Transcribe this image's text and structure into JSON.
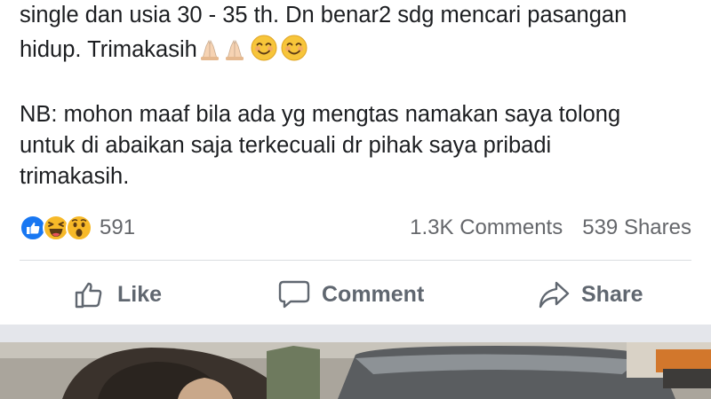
{
  "post": {
    "line1": "single dan usia 30 - 35 th. Dn benar2 sdg mencari pasangan",
    "line2": "hidup. Trimakasih",
    "nb_line1": "NB: mohon maaf bila ada yg mengtas namakan saya tolong",
    "nb_line2": "untuk di abaikan saja terkecuali dr pihak saya pribadi",
    "nb_line3": "trimakasih.",
    "emojis": [
      "folded-hands",
      "folded-hands",
      "smiling-face",
      "smiling-face"
    ]
  },
  "stats": {
    "reactions": [
      "like",
      "haha",
      "wow"
    ],
    "reaction_count": "591",
    "comments": "1.3K Comments",
    "shares": "539 Shares"
  },
  "actions": {
    "like": "Like",
    "comment": "Comment",
    "share": "Share"
  },
  "colors": {
    "text": "#1c1e21",
    "secondary": "#65676b",
    "action": "#606770",
    "like_blue": "#1877f2",
    "reaction_yellow": "#f7b928",
    "divider": "#dadde1",
    "feed_gap": "#e4e6eb"
  }
}
